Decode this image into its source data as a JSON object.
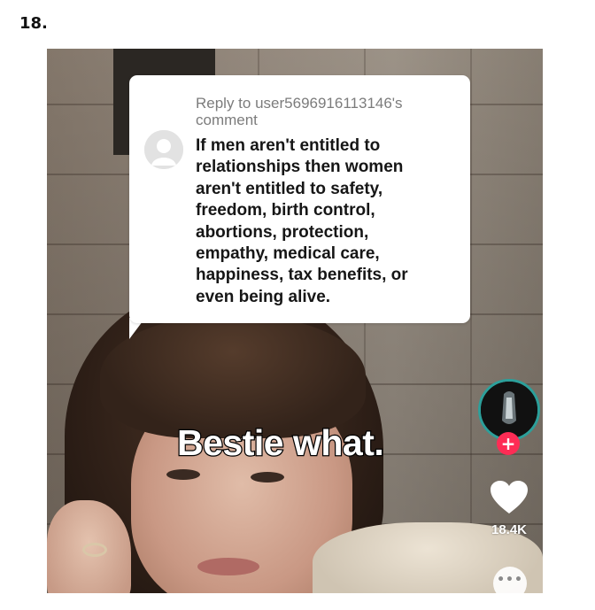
{
  "item_number": "18.",
  "comment": {
    "reply_line_1": "Reply to user5696916113146's",
    "reply_line_2": "comment",
    "body_lines": [
      "If men aren't entitled to",
      "relationships then women",
      "aren't entitled to safety,",
      "freedom, birth control,",
      "abortions, protection,",
      "empathy, medical care,",
      "happiness, tax benefits, or",
      "even being alive."
    ]
  },
  "caption": "Bestie what.",
  "sidebar": {
    "follow_icon": "+",
    "like_count": "18.4K",
    "more_icon": "•••"
  },
  "colors": {
    "follow_accent": "#fe2c55",
    "avatar_ring": "#2c9f9a"
  }
}
